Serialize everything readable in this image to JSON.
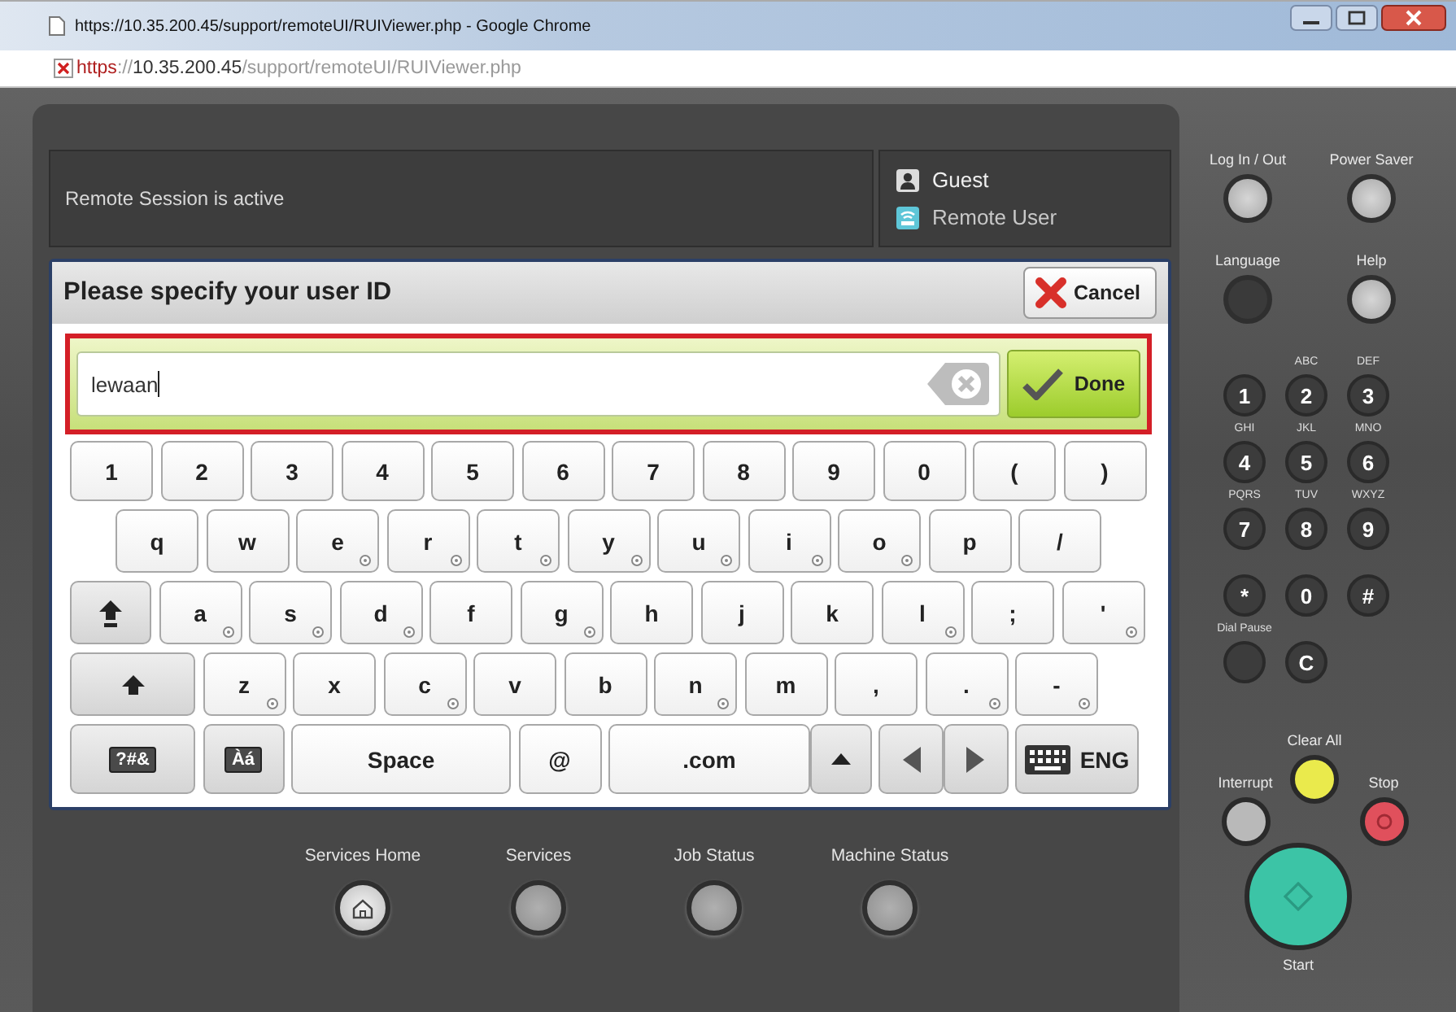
{
  "browser": {
    "title": "https://10.35.200.45/support/remoteUI/RUIViewer.php - Google Chrome",
    "address": {
      "secure": false,
      "scheme": "https",
      "separator": "://",
      "host": "10.35.200.45",
      "path": "/support/remoteUI/RUIViewer.php"
    }
  },
  "session": {
    "message": "Remote Session is active",
    "user": "Guest",
    "user_role": "Remote User"
  },
  "dialog": {
    "title": "Please specify your user ID",
    "cancel": "Cancel",
    "value": "lewaan",
    "done": "Done"
  },
  "keyboard": {
    "rows": [
      {
        "keys": [
          {
            "kind": "char",
            "label": "1",
            "accent": false
          },
          {
            "kind": "char",
            "label": "2",
            "accent": false
          },
          {
            "kind": "char",
            "label": "3",
            "accent": false
          },
          {
            "kind": "char",
            "label": "4",
            "accent": false
          },
          {
            "kind": "char",
            "label": "5",
            "accent": false
          },
          {
            "kind": "char",
            "label": "6",
            "accent": false
          },
          {
            "kind": "char",
            "label": "7",
            "accent": false
          },
          {
            "kind": "char",
            "label": "8",
            "accent": false
          },
          {
            "kind": "char",
            "label": "9",
            "accent": false
          },
          {
            "kind": "char",
            "label": "0",
            "accent": false
          },
          {
            "kind": "char",
            "label": "(",
            "accent": false
          },
          {
            "kind": "char",
            "label": ")",
            "accent": false
          }
        ]
      },
      {
        "keys": [
          {
            "kind": "char",
            "label": "q",
            "accent": false
          },
          {
            "kind": "char",
            "label": "w",
            "accent": false
          },
          {
            "kind": "char",
            "label": "e",
            "accent": true
          },
          {
            "kind": "char",
            "label": "r",
            "accent": true
          },
          {
            "kind": "char",
            "label": "t",
            "accent": true
          },
          {
            "kind": "char",
            "label": "y",
            "accent": true
          },
          {
            "kind": "char",
            "label": "u",
            "accent": true
          },
          {
            "kind": "char",
            "label": "i",
            "accent": true
          },
          {
            "kind": "char",
            "label": "o",
            "accent": true
          },
          {
            "kind": "char",
            "label": "p",
            "accent": false
          },
          {
            "kind": "char",
            "label": "/",
            "accent": false
          }
        ]
      },
      {
        "keys": [
          {
            "kind": "caps",
            "accent": false
          },
          {
            "kind": "char",
            "label": "a",
            "accent": true
          },
          {
            "kind": "char",
            "label": "s",
            "accent": true
          },
          {
            "kind": "char",
            "label": "d",
            "accent": true
          },
          {
            "kind": "char",
            "label": "f",
            "accent": false
          },
          {
            "kind": "char",
            "label": "g",
            "accent": true
          },
          {
            "kind": "char",
            "label": "h",
            "accent": false
          },
          {
            "kind": "char",
            "label": "j",
            "accent": false
          },
          {
            "kind": "char",
            "label": "k",
            "accent": false
          },
          {
            "kind": "char",
            "label": "l",
            "accent": true
          },
          {
            "kind": "char",
            "label": ";",
            "accent": false
          },
          {
            "kind": "char",
            "label": "'",
            "accent": true
          }
        ]
      },
      {
        "keys": [
          {
            "kind": "shift",
            "accent": false
          },
          {
            "kind": "char",
            "label": "z",
            "accent": true
          },
          {
            "kind": "char",
            "label": "x",
            "accent": false
          },
          {
            "kind": "char",
            "label": "c",
            "accent": true
          },
          {
            "kind": "char",
            "label": "v",
            "accent": false
          },
          {
            "kind": "char",
            "label": "b",
            "accent": false
          },
          {
            "kind": "char",
            "label": "n",
            "accent": true
          },
          {
            "kind": "char",
            "label": "m",
            "accent": false
          },
          {
            "kind": "char",
            "label": ",",
            "accent": false
          },
          {
            "kind": "char",
            "label": ".",
            "accent": true
          },
          {
            "kind": "char",
            "label": "-",
            "accent": true
          }
        ]
      },
      {
        "keys": [
          {
            "kind": "symbols",
            "label": "?#&",
            "accent": false
          },
          {
            "kind": "accents",
            "label": "Àá",
            "accent": false
          },
          {
            "kind": "space",
            "label": "Space",
            "accent": false
          },
          {
            "kind": "char",
            "label": "@",
            "accent": false
          },
          {
            "kind": "com",
            "label": ".com",
            "accent": false
          },
          {
            "kind": "up",
            "accent": false
          },
          {
            "kind": "left",
            "accent": false
          },
          {
            "kind": "right",
            "accent": false
          },
          {
            "kind": "lang",
            "label": "ENG",
            "accent": false
          }
        ]
      }
    ]
  },
  "bottom_nav": [
    {
      "kind": "home",
      "label": "Services Home"
    },
    {
      "kind": "plain",
      "label": "Services"
    },
    {
      "kind": "plain",
      "label": "Job Status"
    },
    {
      "kind": "plain",
      "label": "Machine Status"
    }
  ],
  "panel": {
    "top_buttons": [
      {
        "label": "Log In / Out",
        "lit": true
      },
      {
        "label": "Power Saver",
        "lit": true
      },
      {
        "label": "Language",
        "lit": false
      },
      {
        "label": "Help",
        "lit": true
      }
    ],
    "keypad": [
      {
        "digit": "1"
      },
      {
        "digit": "2",
        "caption": "ABC"
      },
      {
        "digit": "3",
        "caption": "DEF"
      },
      {
        "digit": "4",
        "caption": "GHI"
      },
      {
        "digit": "5",
        "caption": "JKL"
      },
      {
        "digit": "6",
        "caption": "MNO"
      },
      {
        "digit": "7",
        "caption": "PQRS"
      },
      {
        "digit": "8",
        "caption": "TUV"
      },
      {
        "digit": "9",
        "caption": "WXYZ"
      },
      {
        "digit": "*"
      },
      {
        "digit": "0"
      },
      {
        "digit": "#"
      },
      {
        "caption": "Dial Pause"
      },
      {
        "digit": "C"
      }
    ],
    "controls": [
      {
        "kind": "clear",
        "label": "Clear All",
        "color": "#eaea4c"
      },
      {
        "kind": "interrupt",
        "label": "Interrupt",
        "color": "#b9b9b9"
      },
      {
        "kind": "stop",
        "label": "Stop",
        "color": "#e0505c"
      },
      {
        "kind": "start",
        "label": "Start",
        "color": "#3cc4a6"
      }
    ]
  }
}
